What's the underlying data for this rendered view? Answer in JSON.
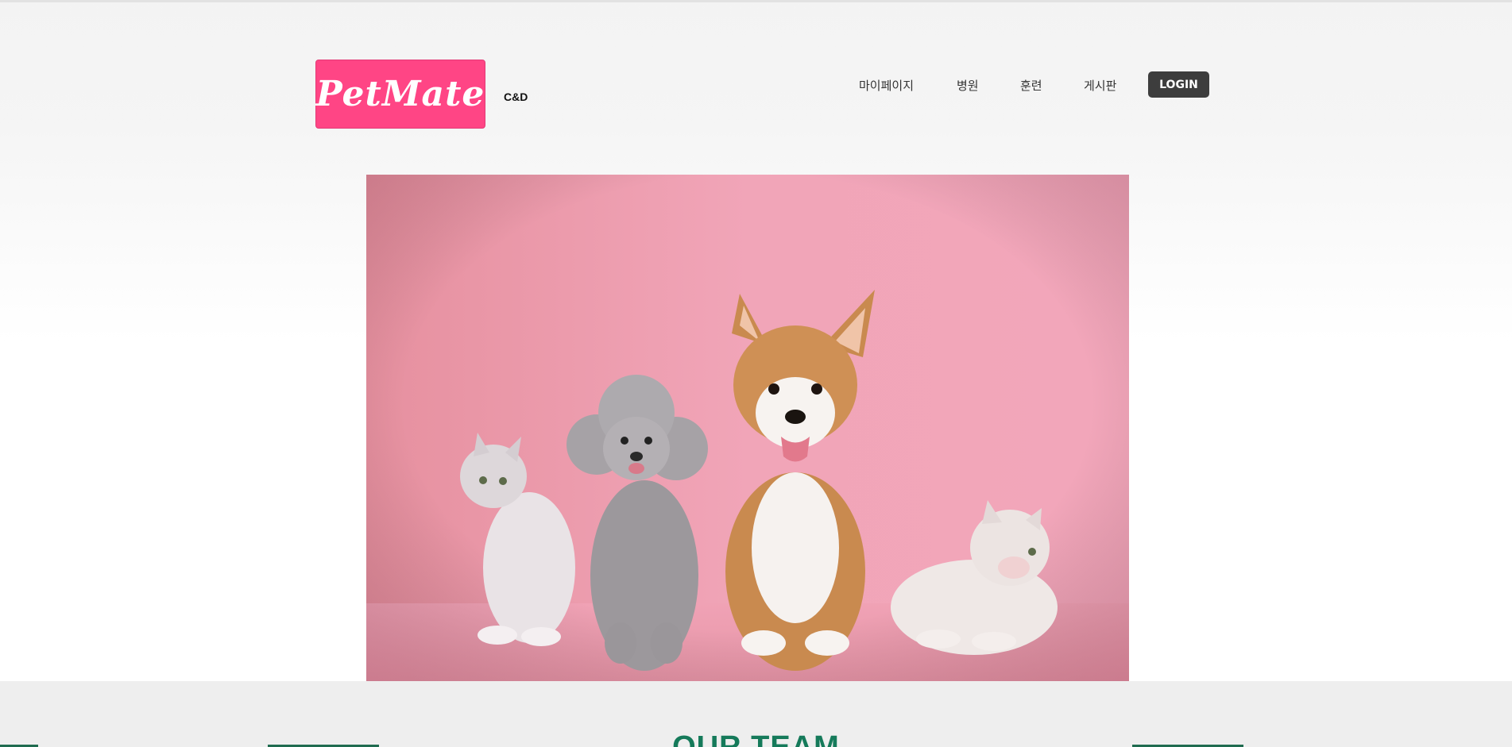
{
  "header": {
    "logo_text": "PetMate",
    "logo_sub": "C&D",
    "nav": [
      "마이페이지",
      "병원",
      "훈련",
      "게시판"
    ],
    "login_label": "LOGIN"
  },
  "team": {
    "title": "OUR TEAM"
  },
  "colors": {
    "brand": "#ff4585",
    "login_bg": "#3d3d3d",
    "team_title": "#157a5a"
  }
}
